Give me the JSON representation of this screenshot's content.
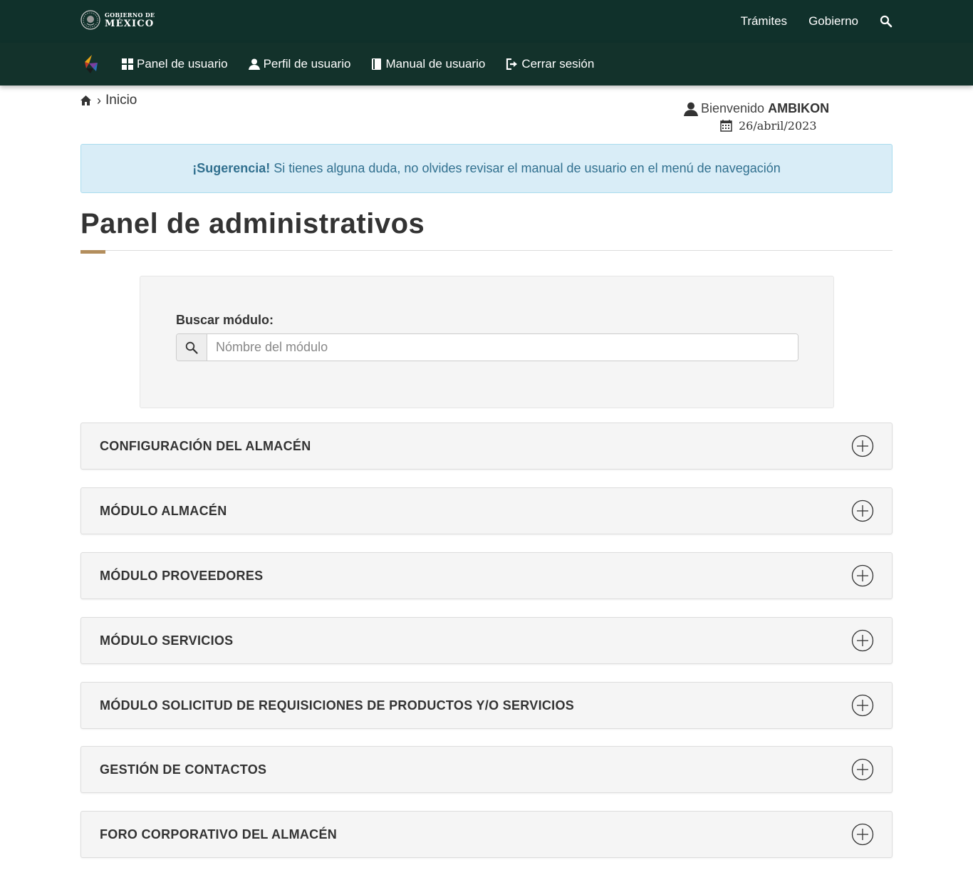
{
  "gov": {
    "logo_line1": "GOBIERNO DE",
    "logo_line2": "MÉXICO",
    "links": [
      "Trámites",
      "Gobierno"
    ],
    "search_icon": "search-icon"
  },
  "nav": {
    "logo_icon": "app-logo-icon",
    "items": [
      {
        "label": "Panel de usuario",
        "icon": "grid-icon"
      },
      {
        "label": "Perfil de usuario",
        "icon": "user-icon"
      },
      {
        "label": "Manual de usuario",
        "icon": "book-icon"
      },
      {
        "label": "Cerrar sesión",
        "icon": "logout-icon"
      }
    ]
  },
  "breadcrumb": {
    "home_icon": "home-icon",
    "separator": "›",
    "current": "Inicio"
  },
  "welcome": {
    "greeting": "Bienvenido",
    "username": "AMBIKON",
    "date": "26/abril/2023"
  },
  "alert": {
    "strong": "¡Sugerencia!",
    "text": "Si tienes alguna duda, no olvides revisar el manual de usuario en el menú de navegación"
  },
  "page": {
    "title": "Panel de administrativos"
  },
  "search": {
    "label": "Buscar módulo:",
    "placeholder": "Nómbre del módulo",
    "value": ""
  },
  "modules": [
    "CONFIGURACIÓN DEL ALMACÉN",
    "MÓDULO ALMACÉN",
    "MÓDULO PROVEEDORES",
    "MÓDULO SERVICIOS",
    "MÓDULO SOLICITUD DE REQUISICIONES DE PRODUCTOS Y/O SERVICIOS",
    "GESTIÓN DE CONTACTOS",
    "FORO CORPORATIVO DEL ALMACÉN"
  ],
  "colors": {
    "top_bar": "#10312b",
    "nav_bar": "#13322b",
    "accent": "#b38e5d",
    "alert_bg": "#d9edf7",
    "alert_text": "#31708f"
  }
}
